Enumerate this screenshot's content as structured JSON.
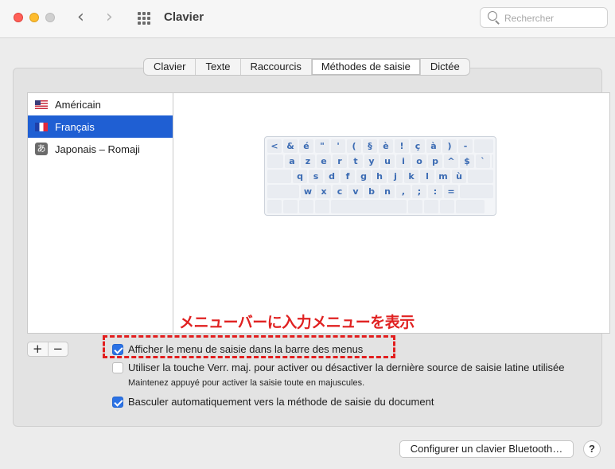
{
  "window": {
    "title": "Clavier",
    "nav_back": "‹",
    "nav_forward": "›",
    "search_placeholder": "Rechercher"
  },
  "tabs": [
    {
      "label": "Clavier",
      "active": false
    },
    {
      "label": "Texte",
      "active": false
    },
    {
      "label": "Raccourcis",
      "active": false
    },
    {
      "label": "Méthodes de saisie",
      "active": true
    },
    {
      "label": "Dictée",
      "active": false
    }
  ],
  "input_sources": [
    {
      "label": "Américain",
      "icon": "us-flag-icon",
      "selected": false
    },
    {
      "label": "Français",
      "icon": "fr-flag-icon",
      "selected": true
    },
    {
      "label": "Japonais – Romaji",
      "icon": "japanese-input-icon",
      "icon_glyph": "あ",
      "selected": false
    }
  ],
  "keyboard_rows": [
    [
      "<",
      "&",
      "é",
      "\"",
      "'",
      "(",
      "§",
      "è",
      "!",
      "ç",
      "à",
      ")",
      "-"
    ],
    [
      "a",
      "z",
      "e",
      "r",
      "t",
      "y",
      "u",
      "i",
      "o",
      "p",
      "^",
      "$",
      "`"
    ],
    [
      "q",
      "s",
      "d",
      "f",
      "g",
      "h",
      "j",
      "k",
      "l",
      "m",
      "ù"
    ],
    [
      "w",
      "x",
      "c",
      "v",
      "b",
      "n",
      ",",
      ";",
      ":",
      "="
    ]
  ],
  "list_buttons": {
    "add": "+",
    "remove": "−"
  },
  "annotation": "メニューバーに入力メニューを表示",
  "options": {
    "show_menu": {
      "label": "Afficher le menu de saisie dans la barre des menus",
      "checked": true
    },
    "caps_lock": {
      "label": "Utiliser la touche Verr. maj. pour activer ou désactiver la dernière source de saisie latine utilisée",
      "checked": false
    },
    "caps_lock_hint": "Maintenez appuyé pour activer la saisie toute en majuscules.",
    "auto_switch": {
      "label": "Basculer automatiquement vers la méthode de saisie du document",
      "checked": true
    }
  },
  "bluetooth_button": "Configurer un clavier Bluetooth…",
  "help_button": "?",
  "colors": {
    "accent": "#2b72e5",
    "selection": "#1f5fd3",
    "annotation_red": "#e02121"
  }
}
